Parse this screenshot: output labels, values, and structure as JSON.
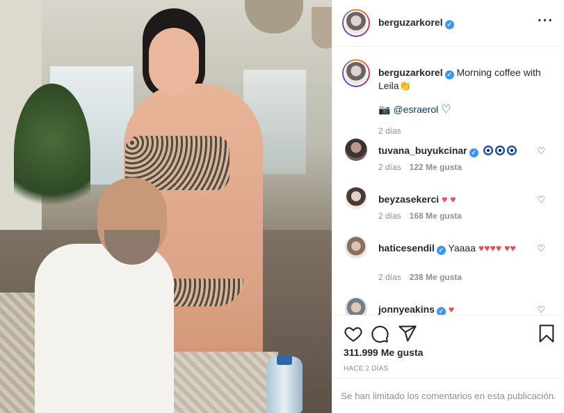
{
  "post": {
    "author": "berguzarkorel",
    "caption_text": " Morning coffee with Leila",
    "caption_emoji": "👏",
    "caption_mention": "@esraerol",
    "caption_time": "2 días",
    "likes": "311.999 Me gusta",
    "posted_ago": "HACE 2 DÍAS",
    "comments_limited": "Se han limitado los comentarios en esta publicación."
  },
  "comments": [
    {
      "user": "tuvana_buyukcinar",
      "verified": true,
      "text": "",
      "emoji": "evil-eye x3",
      "time": "2 días",
      "likes": "122 Me gusta"
    },
    {
      "user": "beyzasekerci",
      "verified": false,
      "text": "",
      "emoji": "♥ ♥",
      "time": "2 días",
      "likes": "168 Me gusta"
    },
    {
      "user": "haticesendil",
      "verified": true,
      "text": " Yaaaa",
      "emoji": "♥♥♥♥ ♥♥",
      "time": "2 días",
      "likes": "238 Me gusta"
    },
    {
      "user": "jonnyeakins",
      "verified": true,
      "text": "",
      "emoji": "♥",
      "time": "",
      "likes": ""
    }
  ],
  "icons": {
    "verified": "verified-badge-icon",
    "more": "more-options-icon",
    "like": "heart-icon",
    "comment": "comment-icon",
    "share": "share-icon",
    "save": "bookmark-icon",
    "camera": "camera-icon"
  },
  "colors": {
    "verified": "#3897f0",
    "heart": "#ed4956",
    "link": "#00376b",
    "muted": "#8e8e8e"
  }
}
